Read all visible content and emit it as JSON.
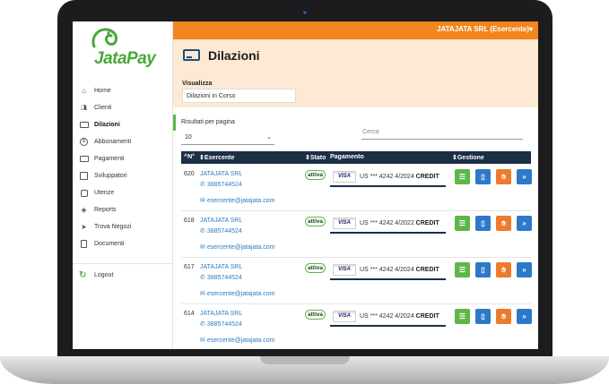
{
  "app": {
    "logo": "JataPay",
    "user_label": "JATAJATA SRL (Esercente)▾"
  },
  "sidebar": {
    "items": [
      {
        "label": "Home",
        "icon": "home-icon"
      },
      {
        "label": "Clienti",
        "icon": "users-icon"
      },
      {
        "label": "Dilazioni",
        "icon": "credit-card-icon"
      },
      {
        "label": "Abbonamenti",
        "icon": "dollar-icon"
      },
      {
        "label": "Pagamenti",
        "icon": "money-icon"
      },
      {
        "label": "Sviluppatori",
        "icon": "code-icon"
      },
      {
        "label": "Utenze",
        "icon": "lock-icon"
      },
      {
        "label": "Reports",
        "icon": "tag-icon"
      },
      {
        "label": "Trova Negozi",
        "icon": "map-pin-icon"
      },
      {
        "label": "Documenti",
        "icon": "document-icon"
      }
    ],
    "active": "Dilazioni",
    "logout": "Logout"
  },
  "header": {
    "title": "Dilazioni",
    "view_label": "Visualizza",
    "view_value": "Dilazioni in Corso"
  },
  "controls": {
    "rows_label": "Risultati per pagina",
    "rows_value": "10",
    "search_placeholder": "Cerca"
  },
  "table": {
    "columns": [
      "^N°",
      "⇕Esercente",
      "⇕Stato",
      "Pagamento",
      "⇕Gestione"
    ],
    "rows": [
      {
        "n": "620",
        "merchant": "JATAJATA SRL",
        "phone": "3885744524",
        "email": "esercente@jatajata.com",
        "status": "attiva",
        "card_brand": "VISA",
        "card": "US *** 4242 4/2024",
        "card_type": "CREDIT"
      },
      {
        "n": "618",
        "merchant": "JATAJATA SRL",
        "phone": "3885744524",
        "email": "esercente@jatajata.com",
        "status": "attiva",
        "card_brand": "VISA",
        "card": "US *** 4242 4/2022",
        "card_type": "CREDIT"
      },
      {
        "n": "617",
        "merchant": "JATAJATA SRL",
        "phone": "3885744524",
        "email": "esercente@jatajata.com",
        "status": "attiva",
        "card_brand": "VISA",
        "card": "US *** 4242 4/2024",
        "card_type": "CREDIT"
      },
      {
        "n": "614",
        "merchant": "JATAJATA SRL",
        "phone": "3885744524",
        "email": "esercente@jatajata.com",
        "status": "attiva",
        "card_brand": "VISA",
        "card": "US *** 4242 4/2024",
        "card_type": "CREDIT"
      }
    ],
    "action_icons": [
      "list-icon",
      "document-icon",
      "hand-stop-icon",
      "forward-icon"
    ]
  },
  "colors": {
    "accent_orange": "#f0861d",
    "brand_green": "#5fb548",
    "header_navy": "#1b2f45",
    "link_blue": "#2f7bbf"
  }
}
